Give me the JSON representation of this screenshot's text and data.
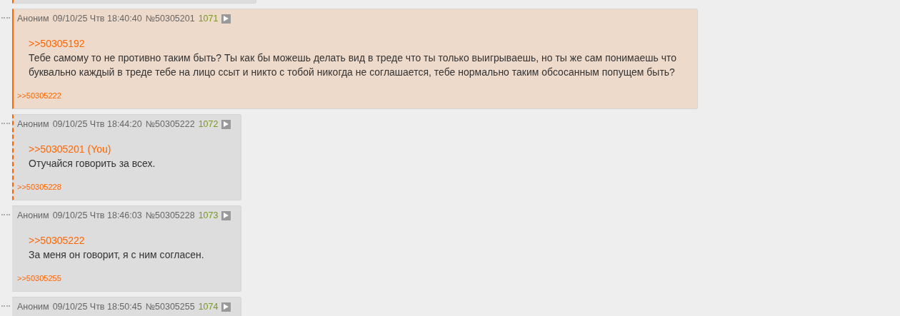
{
  "post_above": {
    "kind": "reply"
  },
  "posts": [
    {
      "kind": "own",
      "author": "Аноним",
      "date": "09/10/25 Чтв 18:40:40",
      "number": "№50305201",
      "index": "1071",
      "quote": ">>50305192",
      "text": "Тебе самому то не противно таким быть? Ты как бы можешь делать вид в треде что ты только выигрываешь, но ты же сам понимаешь что буквально каждый в треде тебе на лицо ссыт и никто с тобой никогда не соглашается, тебе нормально таким обсосанным попущем быть?",
      "replies": [
        ">>50305222"
      ]
    },
    {
      "kind": "reply",
      "author": "Аноним",
      "date": "09/10/25 Чтв 18:44:20",
      "number": "№50305222",
      "index": "1072",
      "quote": ">>50305201 (You)",
      "text": "Отучайся говорить за всех.",
      "replies": [
        ">>50305228"
      ]
    },
    {
      "kind": "normal",
      "author": "Аноним",
      "date": "09/10/25 Чтв 18:46:03",
      "number": "№50305228",
      "index": "1073",
      "quote": ">>50305222",
      "text": "За меня он говорит, я с ним согласен.",
      "replies": [
        ">>50305255"
      ]
    },
    {
      "kind": "normal",
      "author": "Аноним",
      "date": "09/10/25 Чтв 18:50:45",
      "number": "№50305255",
      "index": "1074"
    }
  ]
}
